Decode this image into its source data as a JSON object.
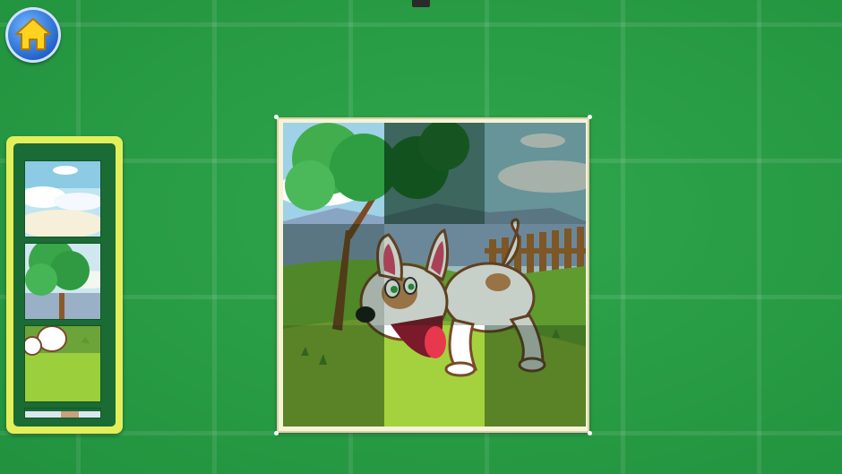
{
  "colors": {
    "background": "#25a244",
    "home_button": "#2f78e0",
    "tray_border": "#e2ef5a",
    "tray_fill": "#1a6b34",
    "board_frame": "#f6f3d7"
  },
  "home_button": {
    "icon": "home-icon"
  },
  "puzzle": {
    "picture": "cartoon-dog-in-field",
    "grid": {
      "columns": 3,
      "rows": 3
    },
    "placed_pieces": [
      {
        "row": 0,
        "col": 0,
        "state": "placed"
      },
      {
        "row": 0,
        "col": 1,
        "state": "empty"
      },
      {
        "row": 0,
        "col": 2,
        "state": "empty"
      },
      {
        "row": 1,
        "col": 0,
        "state": "empty"
      },
      {
        "row": 1,
        "col": 1,
        "state": "empty"
      },
      {
        "row": 1,
        "col": 2,
        "state": "empty"
      },
      {
        "row": 2,
        "col": 0,
        "state": "empty"
      },
      {
        "row": 2,
        "col": 1,
        "state": "placed"
      },
      {
        "row": 2,
        "col": 2,
        "state": "empty"
      }
    ]
  },
  "piece_tray": {
    "pieces": [
      {
        "slot": 0,
        "content": "sky-clouds-piece"
      },
      {
        "slot": 1,
        "content": "tree-piece"
      },
      {
        "slot": 2,
        "content": "grass-paw-piece"
      },
      {
        "slot": 3,
        "content": "partial-piece"
      }
    ]
  }
}
